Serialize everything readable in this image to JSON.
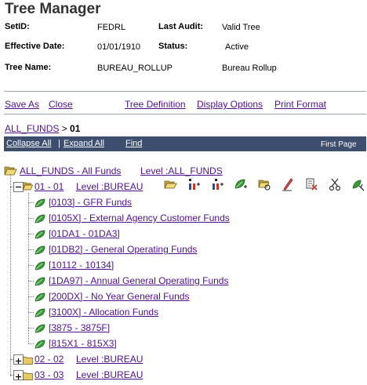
{
  "page": {
    "title": "Tree Manager"
  },
  "header": {
    "setid_label": "SetID:",
    "setid_value": "FEDRL",
    "last_audit_label": "Last Audit:",
    "last_audit_value": "Valid Tree",
    "eff_date_label": "Effective Date:",
    "eff_date_value": "01/01/1910",
    "status_label": "Status:",
    "status_value": "Active",
    "tree_name_label": "Tree Name:",
    "tree_name_value": "BUREAU_ROLLUP",
    "tree_desc": "Bureau Rollup"
  },
  "actions": {
    "save_as": "Save As",
    "close": "Close",
    "tree_definition": "Tree Definition",
    "display_options": "Display Options",
    "print_format": "Print Format"
  },
  "breadcrumb": {
    "root": "ALL_FUNDS",
    "separator": " > ",
    "current": "01"
  },
  "bar": {
    "collapse_all": "Collapse All",
    "divider": "|",
    "expand_all": "Expand All",
    "find": "Find",
    "first_page": "First Page"
  },
  "tree": {
    "root_label": "ALL_FUNDS - All Funds",
    "root_level": "Level :ALL_FUNDS",
    "node1_label": "01 - 01",
    "node1_level": "Level :BUREAU",
    "details": [
      "[0103] - GFR Funds",
      "[0105X] - External Agency Customer Funds",
      "[01DA1 - 01DA3]",
      "[01DB2] - General Operating Funds",
      "[10112 - 10134]",
      "[1DA97] - Annual General Operating Funds",
      "[200DX] - No Year General Funds",
      "[3100X] - Allocation Funds",
      "[3875 - 3875F]",
      "[815X1 - 815X3]"
    ],
    "node2_label": "02 - 02",
    "node2_level": "Level :BUREAU",
    "node3_label": "03 - 03",
    "node3_level": "Level :BUREAU"
  },
  "toolbar_icons": [
    "open-folder-icon",
    "insert-sibling-icon",
    "insert-child-icon",
    "insert-detail-icon",
    "find-node-icon",
    "edit-node-icon",
    "delete-node-icon",
    "cut-icon",
    "paste-icon"
  ],
  "colors": {
    "link": "#51118a",
    "bar": "#3e4e6f",
    "leaf": "#3a9a3a",
    "title": "#333333"
  }
}
